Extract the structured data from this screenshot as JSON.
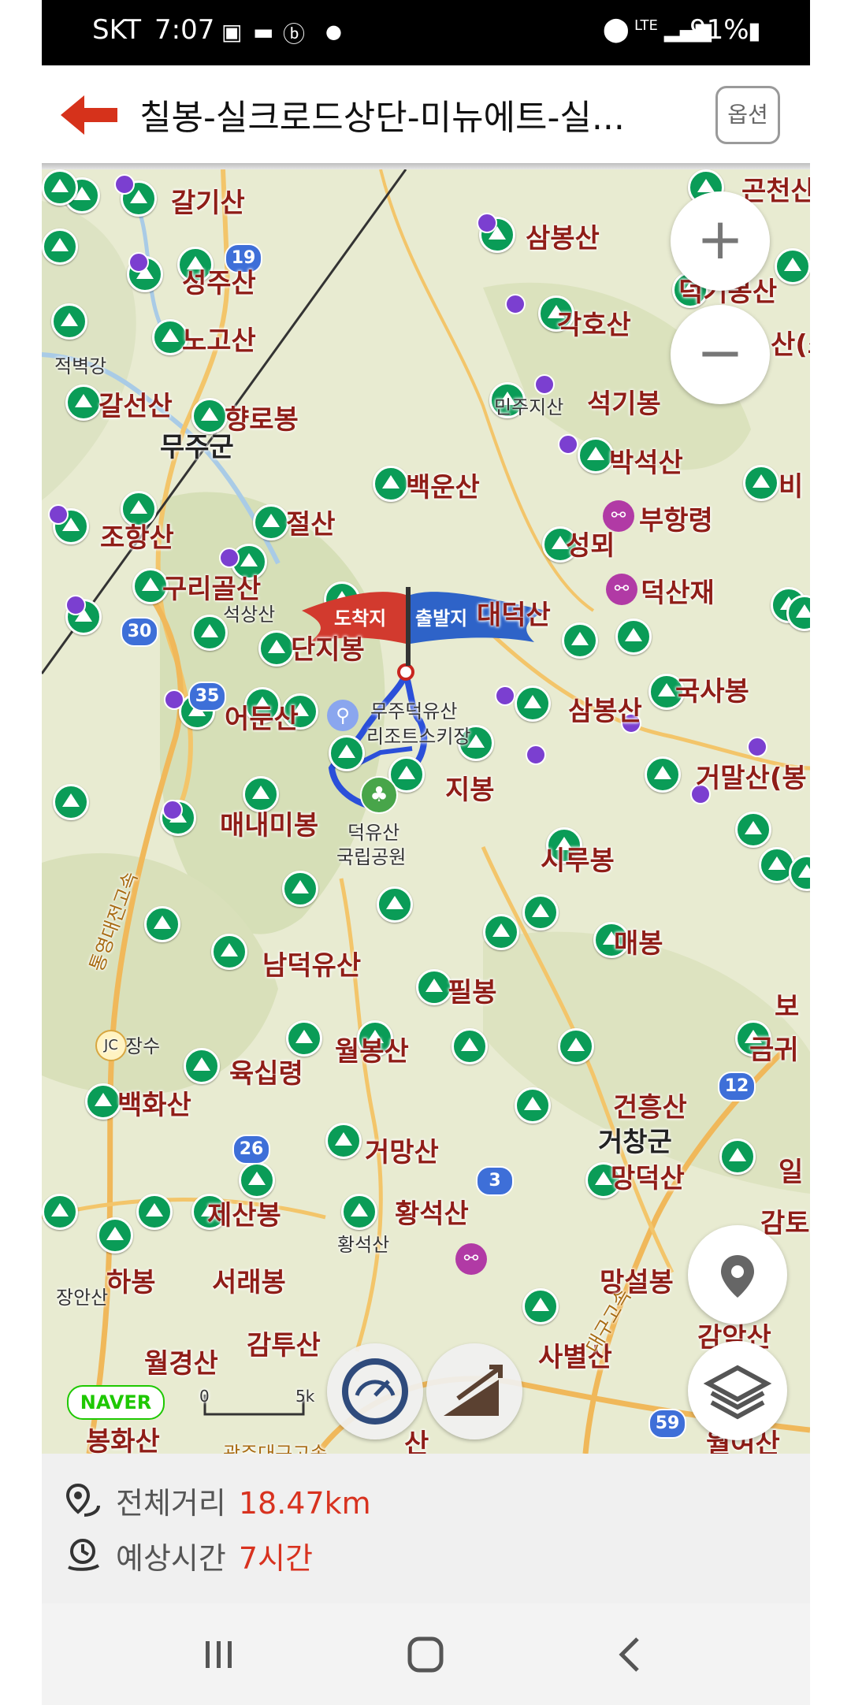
{
  "status_bar": {
    "carrier": "SKT",
    "time": "7:07",
    "battery": "91%",
    "network": "LTE"
  },
  "header": {
    "title": "칠봉-실크로드상단-미뉴에트-실...",
    "options_button": "옵션",
    "back_icon": "arrow-left-icon"
  },
  "map": {
    "labels": [
      {
        "id": "galgisan",
        "text": "갈기산"
      },
      {
        "id": "seongjusan",
        "text": "성주산"
      },
      {
        "id": "nogosan",
        "text": "노고산"
      },
      {
        "id": "jeokbyeokgang",
        "text": "적벽강"
      },
      {
        "id": "galseonsan",
        "text": "갈선산"
      },
      {
        "id": "hyangrobong",
        "text": "향로봉"
      },
      {
        "id": "mujugun",
        "text": "무주군"
      },
      {
        "id": "baekunsan",
        "text": "백운산"
      },
      {
        "id": "jeolsan",
        "text": "절산"
      },
      {
        "id": "johangsan",
        "text": "조항산"
      },
      {
        "id": "gurigolsan",
        "text": "구리골산"
      },
      {
        "id": "seoksangsan",
        "text": "석상산"
      },
      {
        "id": "danjibong",
        "text": "단지봉"
      },
      {
        "id": "eodunsan",
        "text": "어둔산"
      },
      {
        "id": "maenaemibong",
        "text": "매내미봉"
      },
      {
        "id": "deogyusan",
        "text": "덕유산"
      },
      {
        "id": "national_park",
        "text": "국립공원"
      },
      {
        "id": "mujuresort",
        "text": "무주덕유산"
      },
      {
        "id": "resort2",
        "text": "리조트스키장"
      },
      {
        "id": "jibong",
        "text": "지봉"
      },
      {
        "id": "namdeogyusan",
        "text": "남덕유산"
      },
      {
        "id": "pilbong",
        "text": "필봉"
      },
      {
        "id": "wolbongsan",
        "text": "월봉산"
      },
      {
        "id": "yuksimnyeong",
        "text": "육십령"
      },
      {
        "id": "baekhwasan",
        "text": "백화산"
      },
      {
        "id": "jangsu",
        "text": "장수"
      },
      {
        "id": "geomangsan",
        "text": "거망산"
      },
      {
        "id": "jesanbong",
        "text": "제산봉"
      },
      {
        "id": "hwangseoksan",
        "text": "황석산"
      },
      {
        "id": "hwangseoksan2",
        "text": "황석산"
      },
      {
        "id": "habong",
        "text": "하봉"
      },
      {
        "id": "seoraebong",
        "text": "서래봉"
      },
      {
        "id": "janganasan",
        "text": "장안산"
      },
      {
        "id": "gamtusan",
        "text": "감투산"
      },
      {
        "id": "wolgyeongsan",
        "text": "월경산"
      },
      {
        "id": "bonghwasan",
        "text": "봉화산"
      },
      {
        "id": "sambongsan",
        "text": "삼봉산"
      },
      {
        "id": "gakhosan",
        "text": "각호산"
      },
      {
        "id": "minjujisan",
        "text": "민주지산"
      },
      {
        "id": "seokgibong",
        "text": "석기봉"
      },
      {
        "id": "bakseoksan",
        "text": "박석산"
      },
      {
        "id": "buhangryeong",
        "text": "부항령"
      },
      {
        "id": "seongmoe",
        "text": "성뫼"
      },
      {
        "id": "deoksanjae",
        "text": "덕산재"
      },
      {
        "id": "daedeoksan",
        "text": "대덕산"
      },
      {
        "id": "guksabong",
        "text": "국사봉"
      },
      {
        "id": "sambongsan2",
        "text": "삼봉산"
      },
      {
        "id": "geomalsan",
        "text": "거말산(봉"
      },
      {
        "id": "sirubong",
        "text": "시루봉"
      },
      {
        "id": "maebong",
        "text": "매봉"
      },
      {
        "id": "geonheungsan",
        "text": "건흥산"
      },
      {
        "id": "geochanggun",
        "text": "거창군"
      },
      {
        "id": "mangdeoksan",
        "text": "망덕산"
      },
      {
        "id": "mangseolbong",
        "text": "망설봉"
      },
      {
        "id": "sabyeolsan",
        "text": "사별산"
      },
      {
        "id": "gamansan",
        "text": "감악산"
      },
      {
        "id": "woryeosan",
        "text": "월여산"
      },
      {
        "id": "gongcheonsan",
        "text": "곤천산"
      },
      {
        "id": "deokgisan",
        "text": "덕기봉산"
      },
      {
        "id": "bi",
        "text": "비"
      },
      {
        "id": "bo",
        "text": "보"
      },
      {
        "id": "geum",
        "text": "금귀"
      },
      {
        "id": "il",
        "text": "일"
      },
      {
        "id": "gamto",
        "text": "감토"
      },
      {
        "id": "san2",
        "text": "산(스"
      },
      {
        "id": "bottom_san",
        "text": "산"
      },
      {
        "id": "expressway",
        "text": "통영대전고속"
      },
      {
        "id": "gwangju",
        "text": "광주대구고속"
      },
      {
        "id": "expressway2",
        "text": "대구고속"
      }
    ],
    "route_flags": {
      "arrival": "도착지",
      "departure": "출발지"
    },
    "shields": [
      "19",
      "30",
      "35",
      "26",
      "3",
      "12",
      "59"
    ],
    "scale": {
      "start": "0",
      "end": "5k"
    },
    "naver_logo": "NAVER",
    "zoom_in": "+",
    "zoom_out": "−",
    "colors": {
      "route": "#2b4fd9",
      "peak": "#0a9c57",
      "label": "#8f1d17",
      "accent": "#d8321f"
    }
  },
  "route_info": {
    "distance_label": "전체거리",
    "distance_value": "18.47km",
    "time_label": "예상시간",
    "time_value": "7시간"
  }
}
